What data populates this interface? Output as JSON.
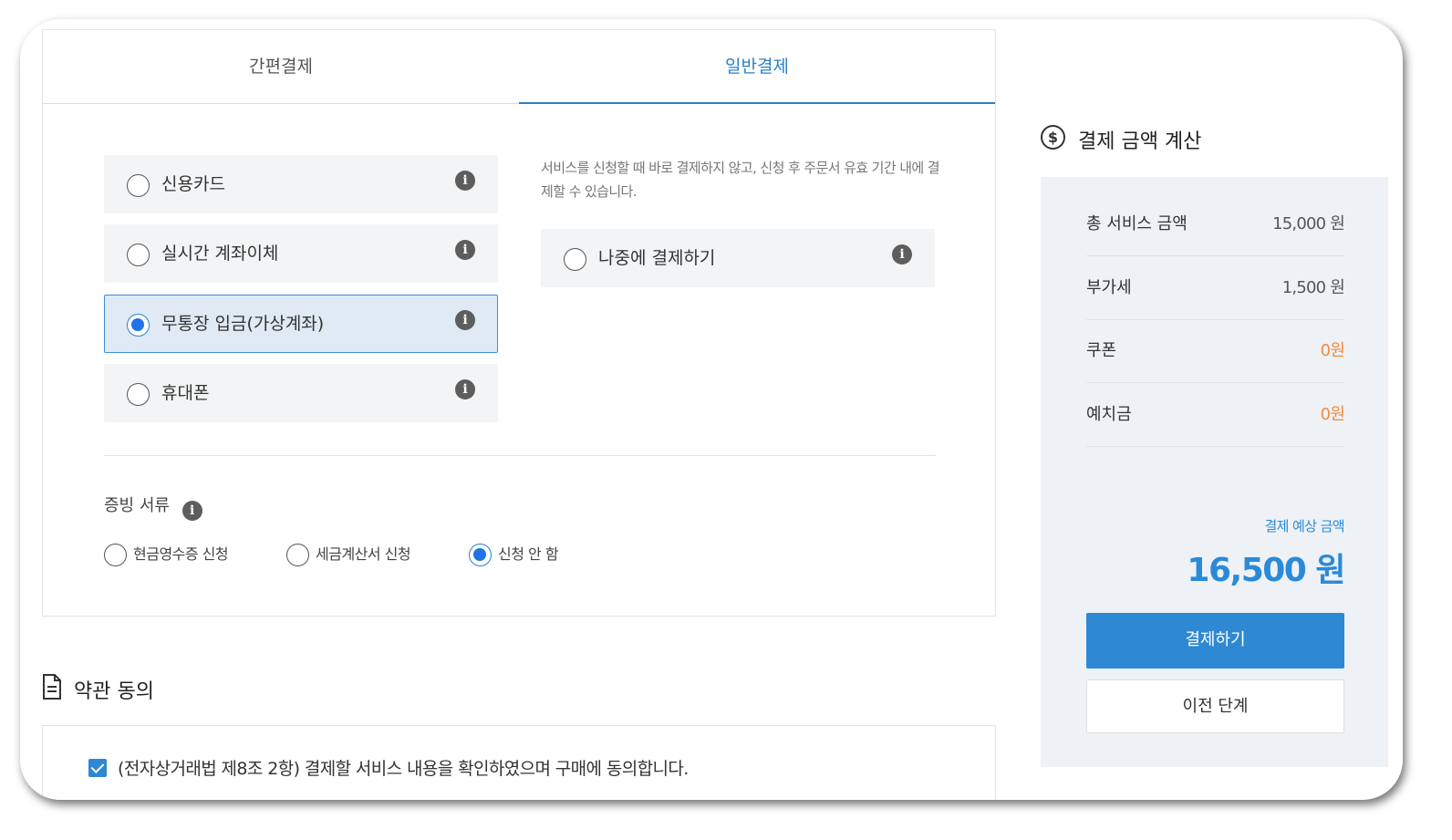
{
  "tabs": [
    {
      "label": "간편결제",
      "active": false
    },
    {
      "label": "일반결제",
      "active": true
    }
  ],
  "payment_methods": [
    {
      "label": "신용카드",
      "selected": false
    },
    {
      "label": "실시간 계좌이체",
      "selected": false
    },
    {
      "label": "무통장 입금(가상계좌)",
      "selected": true
    },
    {
      "label": "휴대폰",
      "selected": false
    }
  ],
  "pay_later": {
    "description": "서비스를 신청할 때 바로 결제하지 않고, 신청 후 주문서 유효 기간 내에 결제할 수 있습니다.",
    "label": "나중에 결제하기",
    "selected": false
  },
  "proof": {
    "title": "증빙 서류",
    "options": [
      {
        "label": "현금영수증 신청",
        "selected": false
      },
      {
        "label": "세금계산서 신청",
        "selected": false
      },
      {
        "label": "신청 안 함",
        "selected": true
      }
    ]
  },
  "terms": {
    "title": "약관 동의",
    "agree_text": "(전자상거래법 제8조 2항) 결제할 서비스 내용을 확인하였으며 구매에 동의합니다.",
    "checked": true
  },
  "summary": {
    "title": "결제 금액 계산",
    "rows": [
      {
        "label": "총 서비스 금액",
        "value": "15,000 원"
      },
      {
        "label": "부가세",
        "value": "1,500 원"
      },
      {
        "label": "쿠폰",
        "value": "0원"
      },
      {
        "label": "예치금",
        "value": "0원"
      }
    ],
    "expected_label": "결제 예상 금액",
    "expected_value": "16,500 원",
    "pay_button": "결제하기",
    "prev_button": "이전 단계"
  },
  "icons": {
    "info": "info-icon",
    "document": "document-icon",
    "dollar": "dollar-circle-icon",
    "info_glyph": "i",
    "dollar_glyph": "$"
  },
  "colors": {
    "accent": "#2e88d4",
    "selected_bg": "#dfeaf4",
    "discount": "#f08a3c"
  }
}
